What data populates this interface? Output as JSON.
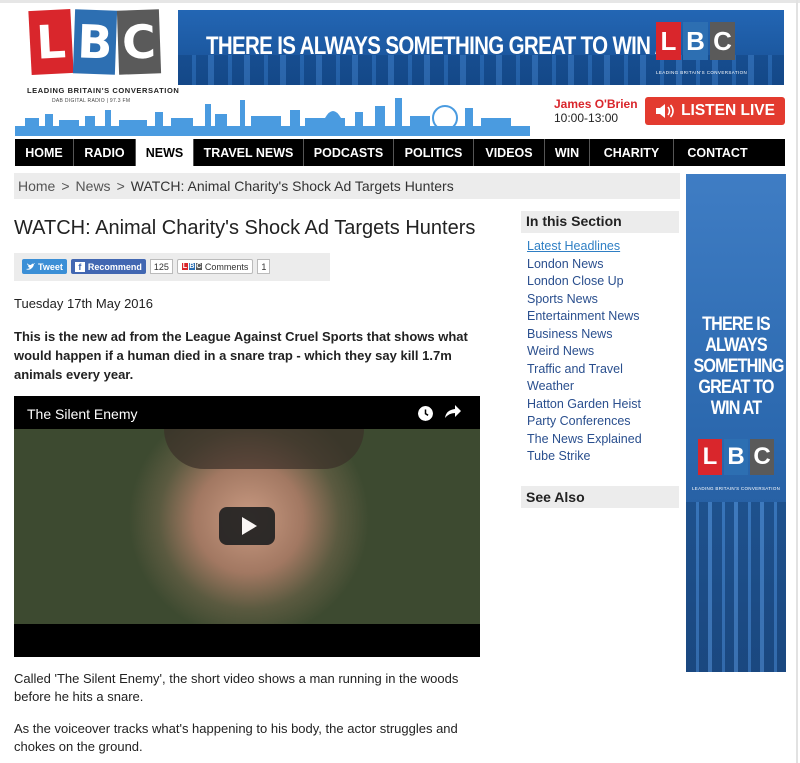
{
  "site": {
    "logo_letters": [
      "L",
      "B",
      "C"
    ],
    "tagline": "LEADING BRITAIN'S CONVERSATION",
    "subtag": "DAB DIGITAL RADIO | 97.3 FM",
    "colors": {
      "red": "#d9262c",
      "blue": "#2d6fb2",
      "grey": "#5a5a5a",
      "listen": "#e33b2f"
    }
  },
  "banner": {
    "text": "THERE IS ALWAYS SOMETHING GREAT TO WIN AT",
    "logo_tag": "LEADING BRITAIN'S CONVERSATION"
  },
  "onair": {
    "presenter": "James O'Brien",
    "time": "10:00-13:00",
    "listen_label": "LISTEN LIVE",
    "listen_icon": "speaker-icon"
  },
  "nav": {
    "items": [
      "HOME",
      "RADIO",
      "NEWS",
      "TRAVEL NEWS",
      "PODCASTS",
      "POLITICS",
      "VIDEOS",
      "WIN",
      "CHARITY",
      "CONTACT"
    ],
    "active": "NEWS"
  },
  "breadcrumb": {
    "home": "Home",
    "sep": ">",
    "news": "News",
    "current": "WATCH: Animal Charity's Shock Ad Targets Hunters"
  },
  "article": {
    "headline": "WATCH: Animal Charity's Shock Ad Targets Hunters",
    "social": {
      "tweet": "Tweet",
      "recommend": "Recommend",
      "recommend_count": "125",
      "comments": "Comments",
      "comments_count": "1"
    },
    "date": "Tuesday 17th May 2016",
    "standfirst": "This is the new ad from the League Against Cruel Sports that shows what would happen if a human died in a snare trap - which they say kill 1.7m animals every year.",
    "video": {
      "title": "The Silent Enemy",
      "icons": [
        "clock-icon",
        "share-icon",
        "play-icon"
      ]
    },
    "paragraphs": [
      "Called 'The Silent Enemy', the short video shows a man running in the woods before he hits a snare.",
      "As the voiceover tracks what's happening to his body, the actor struggles and chokes on the ground."
    ]
  },
  "sidebar": {
    "heading": "In this Section",
    "links": [
      "Latest Headlines",
      "London News",
      "London Close Up",
      "Sports News",
      "Entertainment News",
      "Business News",
      "Weird News",
      "Traffic and Travel",
      "Weather",
      "Hatton Garden Heist",
      "Party Conferences",
      "The News Explained",
      "Tube Strike"
    ],
    "see_also": "See Also"
  },
  "skyscraper_ad": {
    "text": "THERE IS ALWAYS SOMETHING GREAT TO WIN AT",
    "logo_tag": "LEADING BRITAIN'S CONVERSATION"
  }
}
